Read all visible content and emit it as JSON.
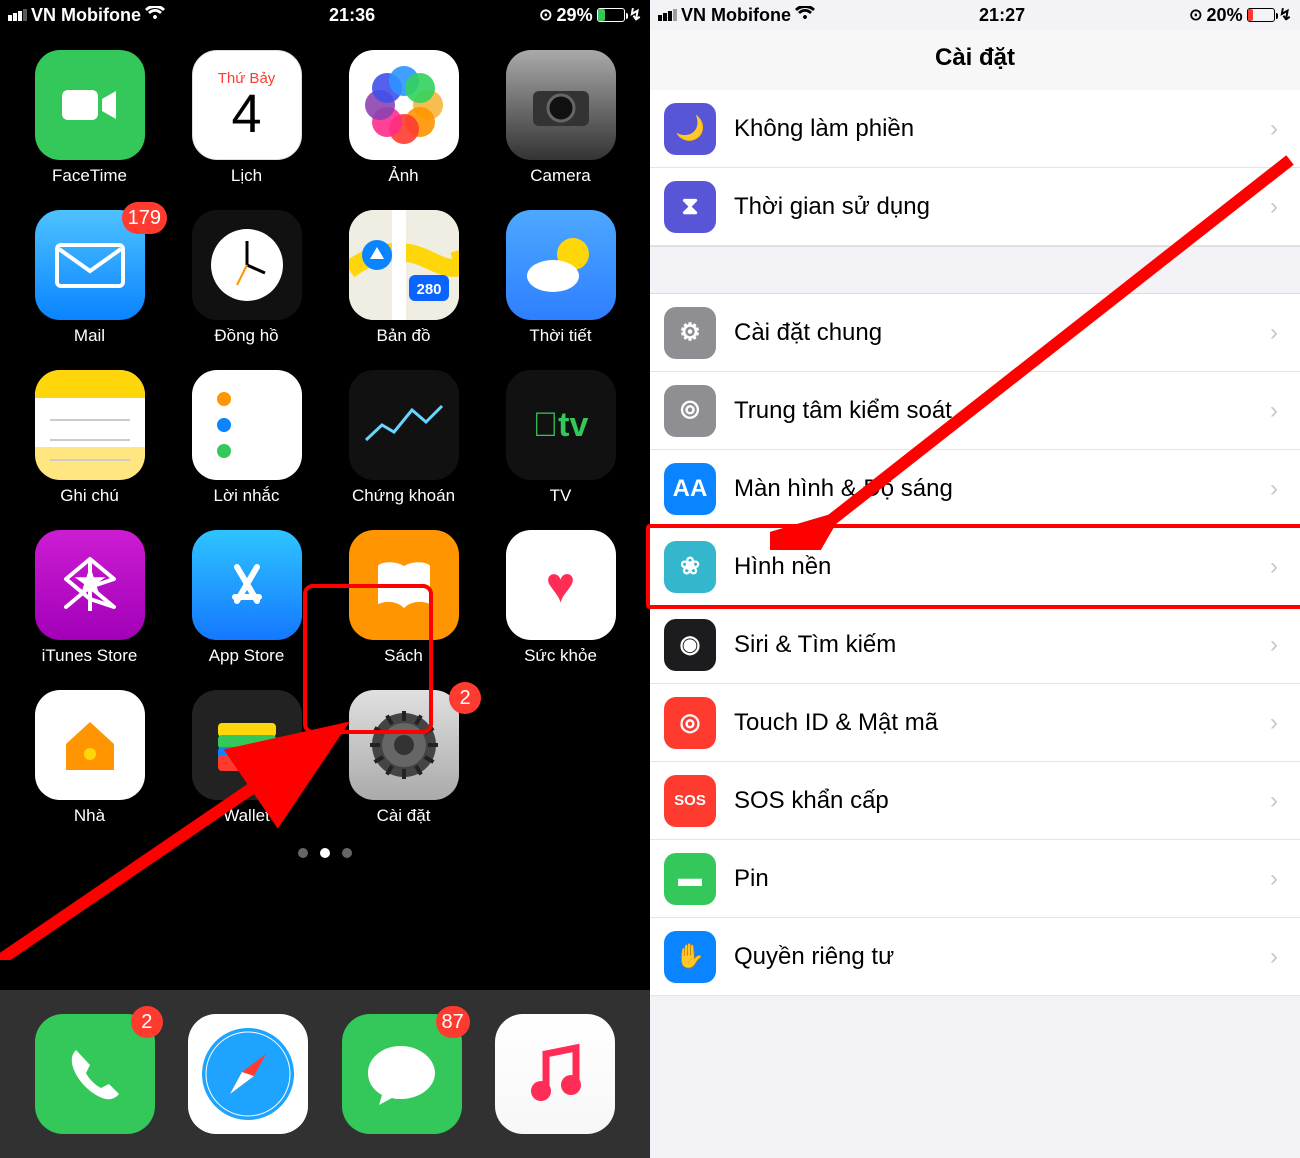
{
  "left": {
    "status": {
      "carrier": "VN Mobifone",
      "time": "21:36",
      "battery": "29%",
      "batteryColor": "#34c759",
      "batteryFill": "29%"
    },
    "apps": [
      {
        "label": "FaceTime",
        "icon": "ic-facetime"
      },
      {
        "label": "Lịch",
        "icon": "ic-calendar",
        "cal_weekday": "Thứ Bảy",
        "cal_day": "4"
      },
      {
        "label": "Ảnh",
        "icon": "ic-photos"
      },
      {
        "label": "Camera",
        "icon": "ic-camera"
      },
      {
        "label": "Mail",
        "icon": "ic-mail",
        "badge": "179"
      },
      {
        "label": "Đồng hồ",
        "icon": "ic-clock"
      },
      {
        "label": "Bản đồ",
        "icon": "ic-maps"
      },
      {
        "label": "Thời tiết",
        "icon": "ic-weather"
      },
      {
        "label": "Ghi chú",
        "icon": "ic-notes"
      },
      {
        "label": "Lời nhắc",
        "icon": "ic-reminders"
      },
      {
        "label": "Chứng khoán",
        "icon": "ic-stocks"
      },
      {
        "label": "TV",
        "icon": "ic-tv"
      },
      {
        "label": "iTunes Store",
        "icon": "ic-itunes"
      },
      {
        "label": "App Store",
        "icon": "ic-appstore"
      },
      {
        "label": "Sách",
        "icon": "ic-books"
      },
      {
        "label": "Sức khỏe",
        "icon": "ic-health"
      },
      {
        "label": "Nhà",
        "icon": "ic-home"
      },
      {
        "label": "Wallet",
        "icon": "ic-wallet"
      },
      {
        "label": "Cài đặt",
        "icon": "ic-settings",
        "badge": "2",
        "highlighted": true
      }
    ],
    "dock": [
      {
        "icon": "ic-phone",
        "badge": "2"
      },
      {
        "icon": "ic-safari"
      },
      {
        "icon": "ic-messages",
        "badge": "87"
      },
      {
        "icon": "ic-music"
      }
    ]
  },
  "right": {
    "status": {
      "carrier": "VN Mobifone",
      "time": "21:27",
      "battery": "20%",
      "batteryColor": "#ff3b30",
      "batteryFill": "20%"
    },
    "title": "Cài đặt",
    "rows": [
      {
        "label": "Không làm phiền",
        "color": "#5856d6",
        "glyph": "🌙"
      },
      {
        "label": "Thời gian sử dụng",
        "color": "#5856d6",
        "glyph": "⧗"
      },
      {
        "gap": true
      },
      {
        "label": "Cài đặt chung",
        "color": "#8e8e93",
        "glyph": "⚙"
      },
      {
        "label": "Trung tâm kiểm soát",
        "color": "#8e8e93",
        "glyph": "⦾"
      },
      {
        "label": "Màn hình & Độ sáng",
        "color": "#0a84ff",
        "glyph": "AA"
      },
      {
        "label": "Hình nền",
        "color": "#34b7cd",
        "glyph": "❀",
        "highlighted": true
      },
      {
        "label": "Siri & Tìm kiếm",
        "color": "#1c1c1e",
        "glyph": "◉"
      },
      {
        "label": "Touch ID & Mật mã",
        "color": "#ff3b30",
        "glyph": "◎"
      },
      {
        "label": "SOS khẩn cấp",
        "color": "#ff3b30",
        "glyph": "SOS",
        "glyphSize": "15px"
      },
      {
        "label": "Pin",
        "color": "#34c759",
        "glyph": "▬"
      },
      {
        "label": "Quyền riêng tư",
        "color": "#0a84ff",
        "glyph": "✋"
      }
    ]
  }
}
